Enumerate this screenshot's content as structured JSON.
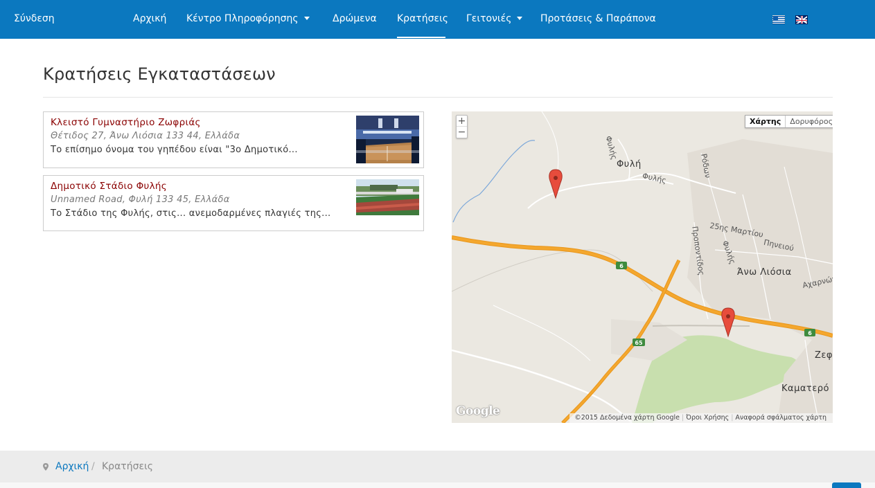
{
  "nav": {
    "login": "Σύνδεση",
    "items": [
      {
        "label": "Αρχική"
      },
      {
        "label": "Κέντρο Πληροφόρησης"
      },
      {
        "label": "Δρώμενα"
      },
      {
        "label": "Κρατήσεις"
      },
      {
        "label": "Γειτονιές"
      },
      {
        "label": "Προτάσεις & Παράπονα"
      }
    ],
    "active": "Κρατήσεις",
    "languages": [
      "greek-flag-icon",
      "uk-flag-icon"
    ]
  },
  "page": {
    "title": "Κρατήσεις Εγκαταστάσεων"
  },
  "facilities": [
    {
      "name": "Κλειστό Γυμναστήριο Ζωφριάς",
      "address": "Θέτιδος 27, Άνω Λιόσια 133 44, Ελλάδα",
      "description": "Το επίσημο όνομα του γηπέδου είναι \"3ο Δημοτικό..."
    },
    {
      "name": "Δημοτικό Στάδιο Φυλής",
      "address": "Unnamed Road, Φυλή 133 45, Ελλάδα",
      "description": "Το Στάδιο της Φυλής, στις... ανεμοδαρμένες πλαγιές της..."
    }
  ],
  "map": {
    "zoom_in": "+",
    "zoom_out": "−",
    "type_map": "Χάρτης",
    "type_satellite": "Δορυφόρος",
    "google": "Google",
    "attribution": "©2015 Δεδομένα χάρτη Google",
    "terms": "Όροι Χρήσης",
    "report": "Αναφορά σφάλματος χάρτη",
    "labels": {
      "fyli_road": "Φυλής",
      "fyli": "Φυλή",
      "fylis2": "Φυλής",
      "rodon": "Ρόδων",
      "martiou": "25ης Μαρτίου",
      "fylis3": "Φυλής",
      "pineiou": "Πηνειού",
      "propontidos": "Προποντίδος",
      "ano_liosia": "Άνω Λιόσια",
      "acharnon": "Αχαρνών",
      "zefyri": "Ζεφ",
      "kamatero": "Καματερό",
      "route6a": "6",
      "route6b": "6",
      "route65": "65"
    }
  },
  "breadcrumb": {
    "home": "Αρχική",
    "separator": "/",
    "current": "Κρατήσεις"
  }
}
